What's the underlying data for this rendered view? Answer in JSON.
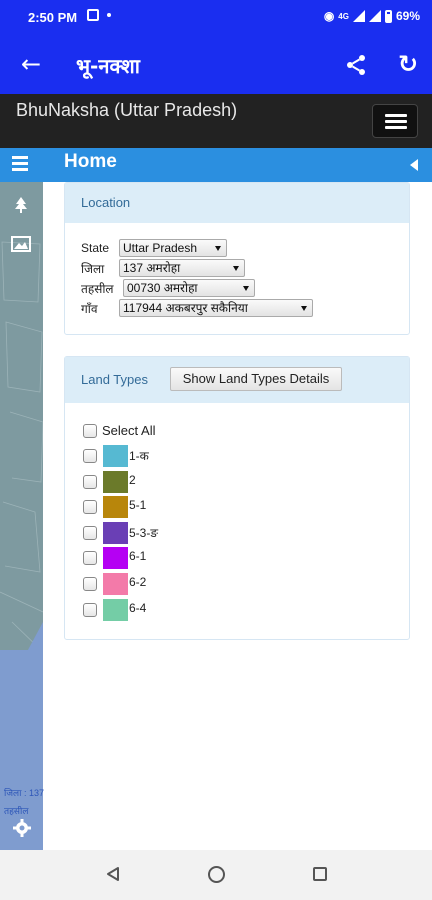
{
  "status_bar": {
    "time": "2:50 PM",
    "battery": "69%",
    "network": "4G"
  },
  "app_bar": {
    "title": "भू-नक्शा"
  },
  "site_header": {
    "title": "BhuNaksha (Uttar Pradesh)"
  },
  "home_bar": {
    "title": "Home"
  },
  "location": {
    "heading": "Location",
    "state_label": "State",
    "state_value": "Uttar Pradesh",
    "district_label": "जिला",
    "district_value": "137 अमरोहा",
    "tehsil_label": "तहसील",
    "tehsil_value": "00730 अमरोहा",
    "village_label": "गाँव",
    "village_value": "117944 अकबरपुर सकैनिया"
  },
  "land_types": {
    "heading": "Land Types",
    "details_button": "Show Land Types Details",
    "select_all": "Select All",
    "items": [
      {
        "label": "1-क",
        "color": "#56b9d2"
      },
      {
        "label": "2",
        "color": "#6b7a2a"
      },
      {
        "label": "5-1",
        "color": "#b8860b"
      },
      {
        "label": "5-3-ङ",
        "color": "#6a3fb5"
      },
      {
        "label": "6-1",
        "color": "#b500f3"
      },
      {
        "label": "6-2",
        "color": "#f37aa9"
      },
      {
        "label": "6-4",
        "color": "#74cda6"
      }
    ]
  },
  "map_footer": {
    "line1": "जिला : 137",
    "line2": "तहसील"
  }
}
